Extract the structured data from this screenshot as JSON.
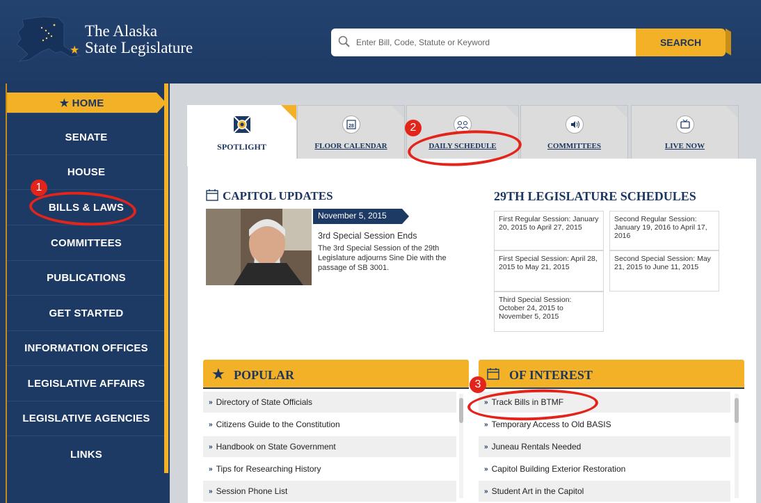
{
  "header": {
    "logo_line1": "The Alaska",
    "logo_line2": "State Legislature",
    "search_placeholder": "Enter Bill, Code, Statute or Keyword",
    "search_button": "SEARCH"
  },
  "sidebar": {
    "items": [
      {
        "label": "★ HOME"
      },
      {
        "label": "SENATE"
      },
      {
        "label": "HOUSE"
      },
      {
        "label": "BILLS & LAWS"
      },
      {
        "label": "COMMITTEES"
      },
      {
        "label": "PUBLICATIONS"
      },
      {
        "label": "GET STARTED"
      },
      {
        "label": "INFORMATION OFFICES"
      },
      {
        "label": "LEGISLATIVE AFFAIRS"
      },
      {
        "label": "LEGISLATIVE AGENCIES"
      },
      {
        "label": "LINKS"
      }
    ]
  },
  "tabs": [
    {
      "label": "SPOTLIGHT",
      "icon": "spotlight-icon",
      "active": true
    },
    {
      "label": "FLOOR CALENDAR",
      "icon": "calendar-icon",
      "calendar_day": "28"
    },
    {
      "label": "DAILY SCHEDULE",
      "icon": "people-icon"
    },
    {
      "label": "COMMITTEES",
      "icon": "speaker-icon"
    },
    {
      "label": "LIVE NOW",
      "icon": "tv-icon"
    }
  ],
  "capitol_updates": {
    "heading": "CAPITOL UPDATES",
    "date": "November 5, 2015",
    "title": "3rd Special Session Ends",
    "body": "The 3rd Special Session of the 29th Legislature adjourns Sine Die with the passage of SB 3001."
  },
  "schedules": {
    "heading": "29TH LEGISLATURE SCHEDULES",
    "cells": [
      "First Regular Session: January 20, 2015 to April 27, 2015",
      "Second Regular Session: January 19, 2016 to April 17, 2016",
      "First Special Session: April 28, 2015 to May 21, 2015",
      "Second Special Session: May 21, 2015 to June 11, 2015",
      "Third Special Session: October 24, 2015 to November 5, 2015"
    ]
  },
  "popular": {
    "heading": "POPULAR",
    "items": [
      "Directory of State Officials",
      "Citizens Guide to the Constitution",
      "Handbook on State Government",
      "Tips for Researching History",
      "Session Phone List"
    ]
  },
  "of_interest": {
    "heading": "OF INTEREST",
    "items": [
      "Track Bills in BTMF",
      "Temporary Access to Old BASIS",
      "Juneau Rentals Needed",
      "Capitol Building Exterior Restoration",
      "Student Art in the Capitol"
    ]
  },
  "annotations": {
    "marker1": "1",
    "marker2": "2",
    "marker3": "3"
  },
  "colors": {
    "navy": "#1d3a64",
    "gold": "#f2b126",
    "annotation_red": "#e3241b"
  }
}
